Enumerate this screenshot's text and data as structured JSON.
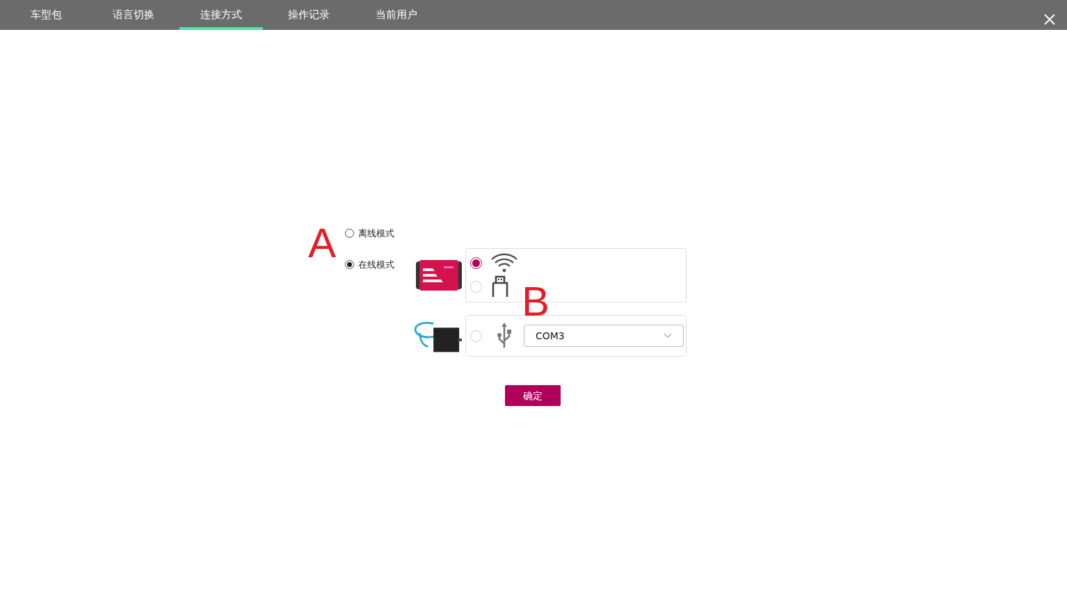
{
  "tabs": [
    {
      "label": "车型包",
      "selected": false
    },
    {
      "label": "语言切换",
      "selected": false
    },
    {
      "label": "连接方式",
      "selected": true
    },
    {
      "label": "操作记录",
      "selected": false
    },
    {
      "label": "当前用户",
      "selected": false
    }
  ],
  "annotations": [
    "A",
    "B"
  ],
  "modes": [
    {
      "label": "离线模式",
      "selected": false
    },
    {
      "label": "在线模式",
      "selected": true
    }
  ],
  "devices": [
    {
      "kind": "wireless",
      "options": [
        {
          "kind": "wifi",
          "selected": true
        },
        {
          "kind": "usb-plug",
          "selected": false
        }
      ]
    },
    {
      "kind": "serial",
      "options": [
        {
          "kind": "usb",
          "selected": false
        }
      ],
      "port": {
        "value": "COM3"
      }
    }
  ],
  "confirm_button": "确定"
}
